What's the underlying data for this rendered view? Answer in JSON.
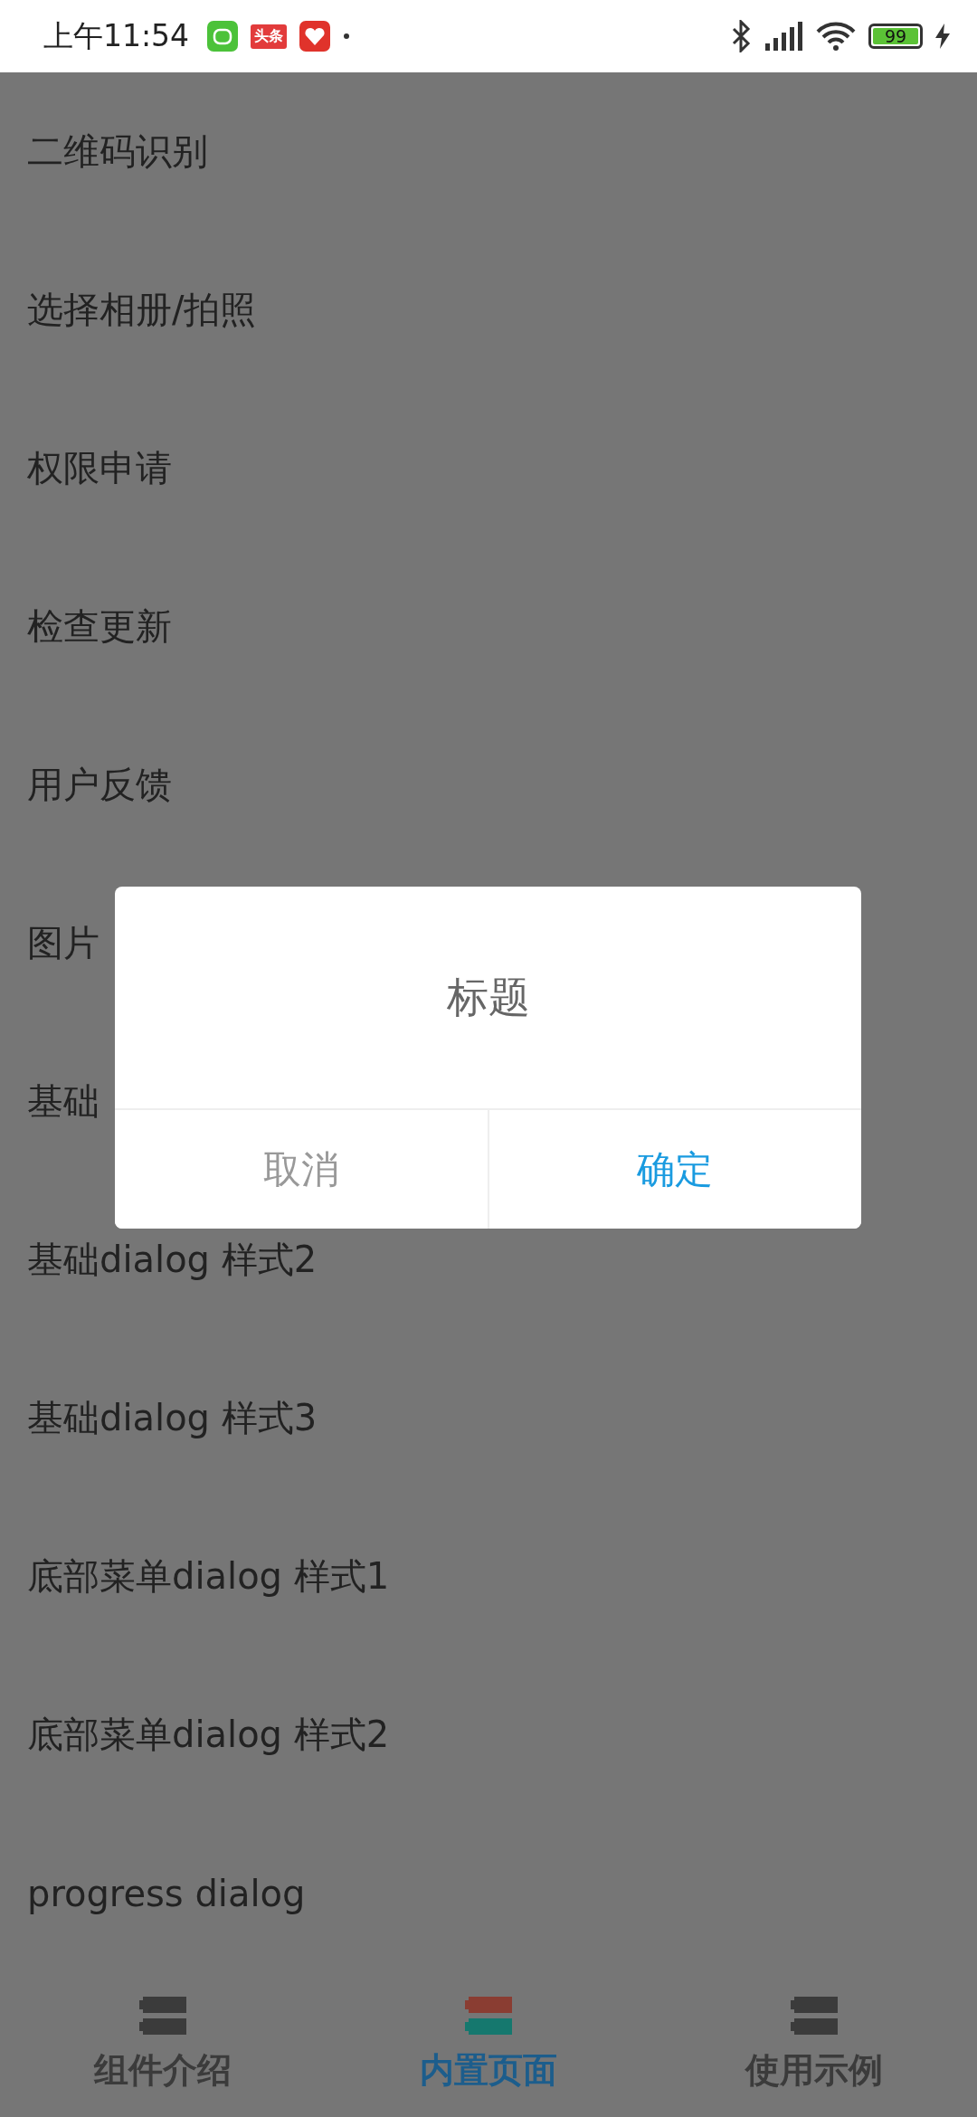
{
  "status_bar": {
    "time": "上午11:54",
    "news_app_label": "头条",
    "battery": "99"
  },
  "list": [
    {
      "label": "二维码识别"
    },
    {
      "label": "选择相册/拍照"
    },
    {
      "label": "权限申请"
    },
    {
      "label": "检查更新"
    },
    {
      "label": "用户反馈"
    },
    {
      "label": "图片"
    },
    {
      "label": "基础"
    },
    {
      "label": "基础dialog 样式2"
    },
    {
      "label": "基础dialog 样式3"
    },
    {
      "label": "底部菜单dialog 样式1"
    },
    {
      "label": "底部菜单dialog 样式2"
    },
    {
      "label": "progress dialog"
    }
  ],
  "dialog": {
    "title": "标题",
    "buttons": [
      {
        "label": "取消",
        "kind": "cancel"
      },
      {
        "label": "确定",
        "kind": "confirm"
      }
    ]
  },
  "tabs": [
    {
      "label": "组件介绍",
      "selected": false
    },
    {
      "label": "内置页面",
      "selected": true
    },
    {
      "label": "使用示例",
      "selected": false
    }
  ]
}
